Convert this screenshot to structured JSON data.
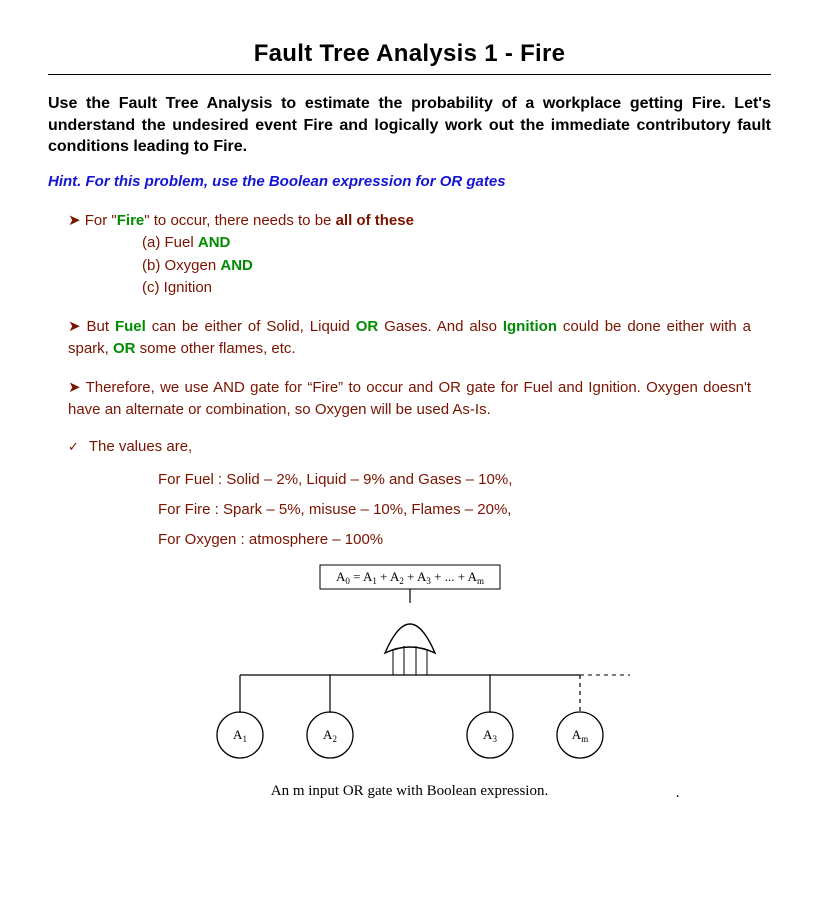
{
  "title": "Fault Tree Analysis 1 - Fire",
  "intro": "Use the Fault Tree Analysis to estimate the probability of a workplace getting Fire. Let's understand the undesired event Fire and logically work out the immediate contributory fault conditions leading to Fire.",
  "hint": "Hint. For this problem, use the Boolean expression for OR gates",
  "p1": {
    "arrow": "➤",
    "pre": " For ",
    "fire": "Fire",
    "post": " to occur, there needs to be ",
    "bold_tail": "all of these",
    "a_pre": "(a) Fuel  ",
    "a_bold": "AND",
    "b_pre": "(b) Oxygen ",
    "b_bold": "AND",
    "c": "(c) Ignition"
  },
  "p2": {
    "arrow": "➤",
    "pre": " But ",
    "fuel": "Fuel",
    "mid1": " can be either of Solid, Liquid ",
    "or1": "OR",
    "mid2": " Gases. And also ",
    "ign": "Ignition",
    "mid3": " could be done either with a spark, ",
    "or2": "OR",
    "tail": " some other flames, etc."
  },
  "p3": {
    "arrow": "➤",
    "text": " Therefore, we use AND gate for “Fire” to occur and OR gate for Fuel and Ignition. Oxygen doesn't have an alternate or combination, so Oxygen will be used As-Is."
  },
  "values_title": "The values are,",
  "values": {
    "fuel": "For Fuel : Solid – 2%, Liquid – 9% and Gases – 10%,",
    "fire": "For Fire  : Spark – 5%, misuse – 10%, Flames – 20%,",
    "oxygen": "For Oxygen : atmosphere  – 100%"
  },
  "diagram": {
    "equation_plain": "A₀ = A₁ + A₂ + A₃ + ... + Aₘ",
    "a1": "A",
    "a1s": "1",
    "a2": "A",
    "a2s": "2",
    "a3": "A",
    "a3s": "3",
    "am": "A",
    "ams": "m",
    "caption": "An m input OR gate with Boolean expression.",
    "dot": "."
  }
}
